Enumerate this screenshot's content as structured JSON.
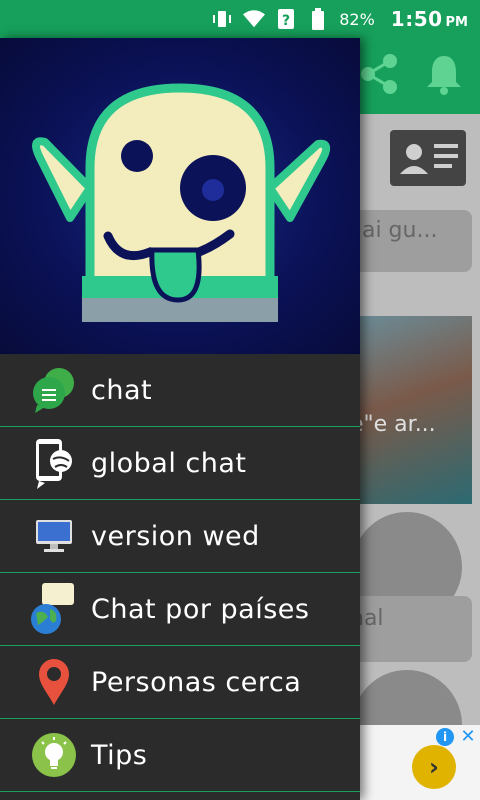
{
  "status_bar": {
    "battery_percent": "82%",
    "time": "1:50",
    "ampm": "PM"
  },
  "background": {
    "preview_1": "dai gu...",
    "preview_2": "e\"e ar...",
    "preview_3": "nal"
  },
  "drawer": {
    "menu": [
      {
        "label": "chat",
        "icon": "chat-bubbles-icon"
      },
      {
        "label": "global chat",
        "icon": "phone-globe-icon"
      },
      {
        "label": "version wed",
        "icon": "monitor-icon"
      },
      {
        "label": "Chat por países",
        "icon": "globe-chat-icon"
      },
      {
        "label": "Personas cerca",
        "icon": "map-pin-icon"
      },
      {
        "label": "Tips",
        "icon": "lightbulb-icon"
      }
    ]
  },
  "colors": {
    "accent": "#16a05b",
    "drawer_bg": "#2b2b2b"
  }
}
